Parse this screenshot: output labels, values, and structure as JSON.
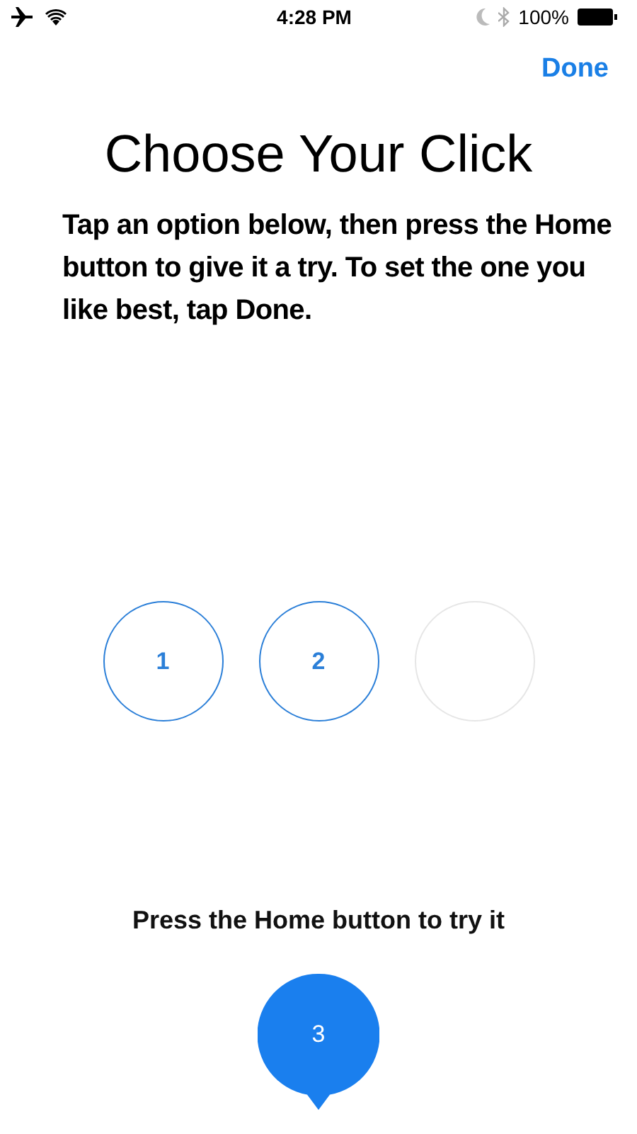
{
  "status_bar": {
    "time": "4:28 PM",
    "battery": "100%"
  },
  "nav": {
    "done": "Done"
  },
  "title": "Choose Your Click",
  "instructions": "Tap an option below, then press the Home button to give it a try. To set the one you like best, tap Done.",
  "options": [
    {
      "label": "1",
      "selected": false
    },
    {
      "label": "2",
      "selected": false
    },
    {
      "selected": true
    }
  ],
  "hint": "Press the Home button to try it",
  "bubble": {
    "label": "3"
  }
}
